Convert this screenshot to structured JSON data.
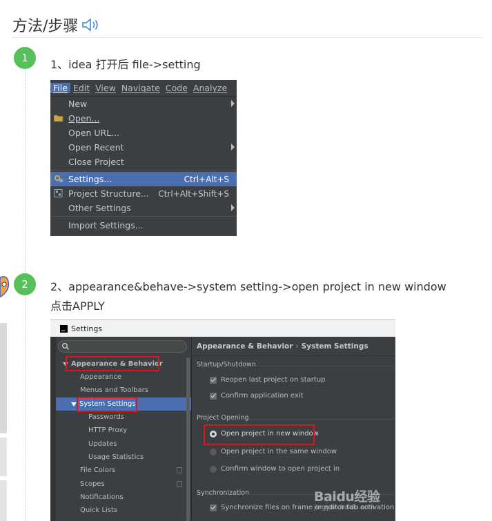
{
  "header": {
    "title": "方法/步骤",
    "speaker_icon": "speaker-icon"
  },
  "steps": [
    {
      "number": "1",
      "text": "1、idea 打开后 file->setting"
    },
    {
      "number": "2",
      "text_line1": "2、appearance&behave->system setting->open project in new window",
      "text_line2": "点击APPLY"
    }
  ],
  "menu_shot": {
    "menubar": [
      "File",
      "Edit",
      "View",
      "Navigate",
      "Code",
      "Analyze"
    ],
    "items": [
      {
        "label": "New",
        "shortcut": "",
        "submenu": true
      },
      {
        "label": "Open...",
        "shortcut": "",
        "icon": "folder-icon"
      },
      {
        "label": "Open URL...",
        "shortcut": ""
      },
      {
        "label": "Open Recent",
        "shortcut": "",
        "submenu": true
      },
      {
        "label": "Close Project",
        "shortcut": ""
      },
      {
        "label": "Settings...",
        "shortcut": "Ctrl+Alt+S",
        "selected": true,
        "icon": "settings-icon"
      },
      {
        "label": "Project Structure...",
        "shortcut": "Ctrl+Alt+Shift+S",
        "icon": "project-structure-icon"
      },
      {
        "label": "Other Settings",
        "shortcut": "",
        "submenu": true
      },
      {
        "label": "Import Settings...",
        "shortcut": ""
      }
    ]
  },
  "settings_shot": {
    "window_title": "Settings",
    "breadcrumb_part1": "Appearance & Behavior",
    "breadcrumb_sep": "›",
    "breadcrumb_part2": "System Settings",
    "tree": [
      {
        "label": "Appearance & Behavior",
        "expanded": true
      },
      {
        "label": "Appearance"
      },
      {
        "label": "Menus and Toolbars"
      },
      {
        "label": "System Settings",
        "expanded": true,
        "selected": true
      },
      {
        "label": "Passwords"
      },
      {
        "label": "HTTP Proxy"
      },
      {
        "label": "Updates"
      },
      {
        "label": "Usage Statistics"
      },
      {
        "label": "File Colors"
      },
      {
        "label": "Scopes"
      },
      {
        "label": "Notifications"
      },
      {
        "label": "Quick Lists"
      }
    ],
    "groups": {
      "startup": "Startup/Shutdown",
      "project_opening": "Project Opening",
      "synchronization": "Synchronization"
    },
    "options": {
      "reopen_last": "Reopen last project on startup",
      "confirm_exit": "Confirm application exit",
      "open_new_window": "Open project in new window",
      "open_same_window": "Open project in the same window",
      "confirm_window": "Confirm window to open project in",
      "sync_files": "Synchronize files on frame or editor tab activation"
    }
  },
  "watermark": {
    "brand": "Baidu经验",
    "url": "jingyan.baidu.com"
  },
  "colors": {
    "step_badge": "#57c159",
    "highlight_box": "#e0141e",
    "ide_selection": "#4b6eaf",
    "ide_background": "#3c3f41"
  }
}
